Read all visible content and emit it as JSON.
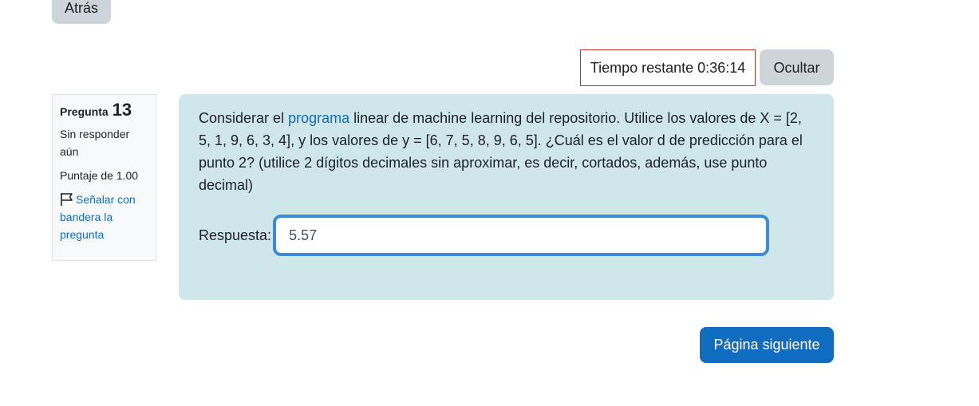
{
  "nav": {
    "back_label": "Atrás"
  },
  "timer": {
    "label": "Tiempo restante",
    "value": "0:36:14",
    "hide_label": "Ocultar"
  },
  "question_info": {
    "question_word": "Pregunta",
    "number": "13",
    "status": "Sin responder aún",
    "score": "Puntaje de 1.00",
    "flag_label": "Señalar con bandera la pregunta"
  },
  "question": {
    "text_before_link": "Considerar el ",
    "link_text": "programa",
    "text_after_link": " linear de machine learning del repositorio. Utilice los valores de X = [2, 5, 1, 9, 6, 3, 4], y los valores de y = [6, 7, 5, 8, 9, 6, 5]. ¿Cuál es el valor d de predicción para el punto 2? (utilice 2 dígitos decimales sin aproximar, es decir, cortados, además, use punto decimal)",
    "answer_label": "Respuesta:",
    "answer_value": "5.57"
  },
  "footer": {
    "next_label": "Página siguiente"
  },
  "colors": {
    "accent": "#0f6cbf",
    "question_bg": "#cfe6ea",
    "timer_border": "#ca3120",
    "secondary_button": "#ced4da"
  }
}
